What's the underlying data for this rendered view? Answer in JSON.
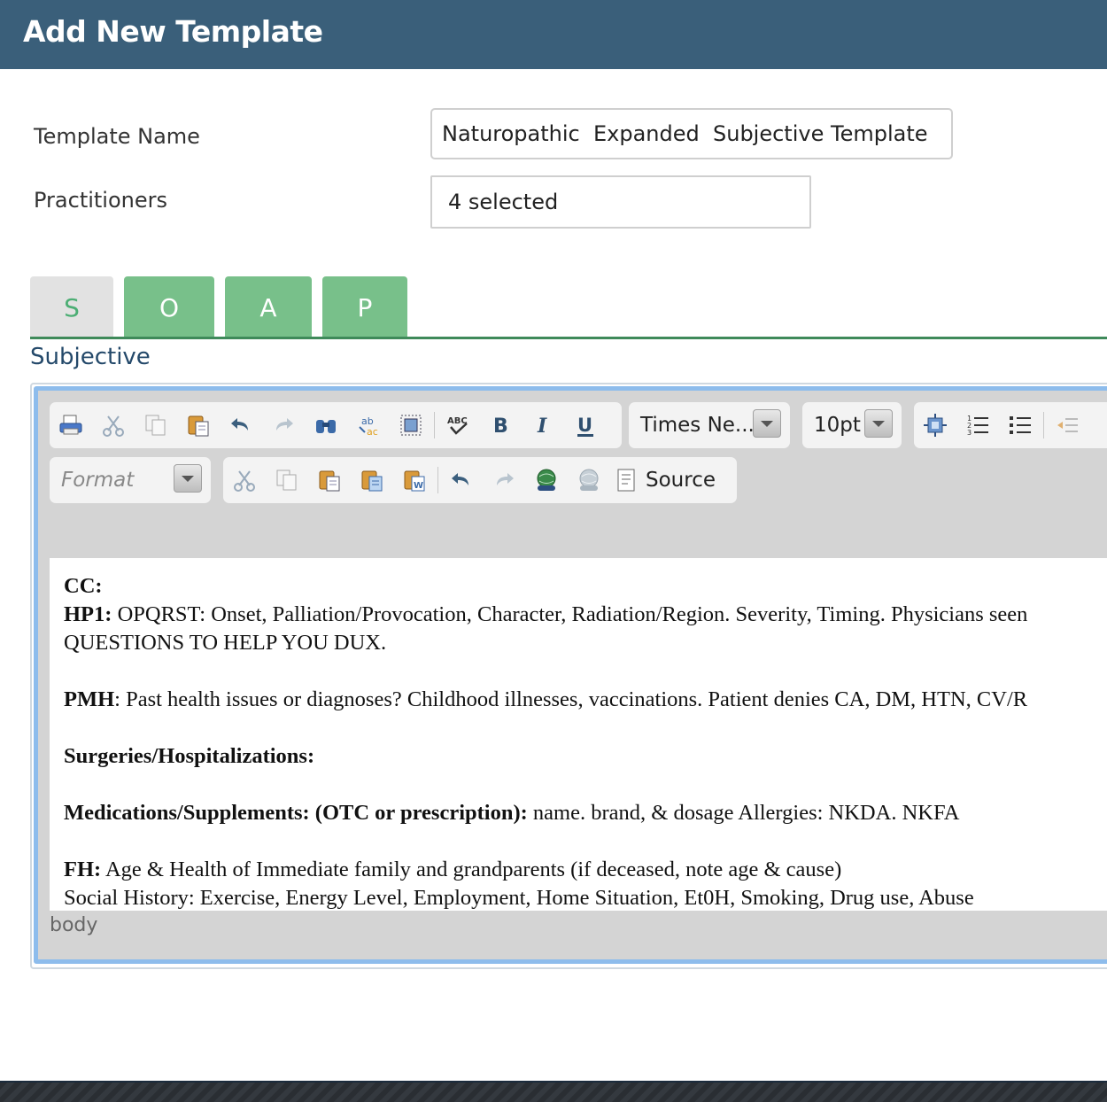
{
  "header": {
    "title": "Add New Template"
  },
  "form": {
    "template_name_label": "Template Name",
    "template_name_value": "Naturopathic  Expanded  Subjective Template",
    "practitioners_label": "Practitioners",
    "practitioners_value": "4 selected"
  },
  "tabs": [
    {
      "label": "S",
      "active": true
    },
    {
      "label": "O",
      "active": false
    },
    {
      "label": "A",
      "active": false
    },
    {
      "label": "P",
      "active": false
    }
  ],
  "section_title": "Subjective",
  "toolbar": {
    "font_family": "Times Ne...",
    "font_size": "10pt",
    "format_placeholder": "Format",
    "source_label": "Source",
    "icons_row1": [
      "print-icon",
      "cut-icon",
      "copy-icon",
      "paste-icon",
      "undo-icon",
      "redo-icon",
      "find-icon",
      "replace-icon",
      "select-all-icon",
      "spellcheck-icon",
      "bold-icon",
      "italic-icon",
      "underline-icon"
    ],
    "icons_row1_right": [
      "insert-object-icon",
      "numbered-list-icon",
      "bulleted-list-icon",
      "outdent-icon"
    ],
    "icons_row2": [
      "cut-icon",
      "copy-icon",
      "paste-icon",
      "paste-text-icon",
      "paste-word-icon",
      "undo-icon",
      "redo-icon",
      "link-icon",
      "unlink-icon",
      "source-icon"
    ]
  },
  "content": {
    "cc_label": "CC:",
    "hp1_label": "HP1:",
    "hp1_text": " OPQRST: Onset, Palliation/Provocation, Character, Radiation/Region. Severity, Timing. Physicians seen",
    "hp1_text2": "QUESTIONS TO HELP YOU DUX.",
    "pmh_label": "PMH",
    "pmh_text": ": Past health issues or diagnoses? Childhood illnesses, vaccinations. Patient denies CA, DM, HTN, CV/R",
    "surgeries_label": "Surgeries/Hospitalizations:",
    "meds_label": "Medications/Supplements: (OTC or prescription):",
    "meds_text": " name. brand, & dosage Allergies: NKDA. NKFA",
    "fh_label": "FH:",
    "fh_text": " Age & Health of Immediate family and grandparents (if deceased, note age & cause)",
    "social_text": "Social History: Exercise, Energy Level, Employment, Home Situation, Et0H, Smoking, Drug use, Abuse"
  },
  "status_bar": {
    "path": "body"
  },
  "colors": {
    "header_bg": "#3a5f7a",
    "tab_green": "#78c08a",
    "tab_inactive": "#e2e2e2",
    "section_title": "#24496a"
  }
}
